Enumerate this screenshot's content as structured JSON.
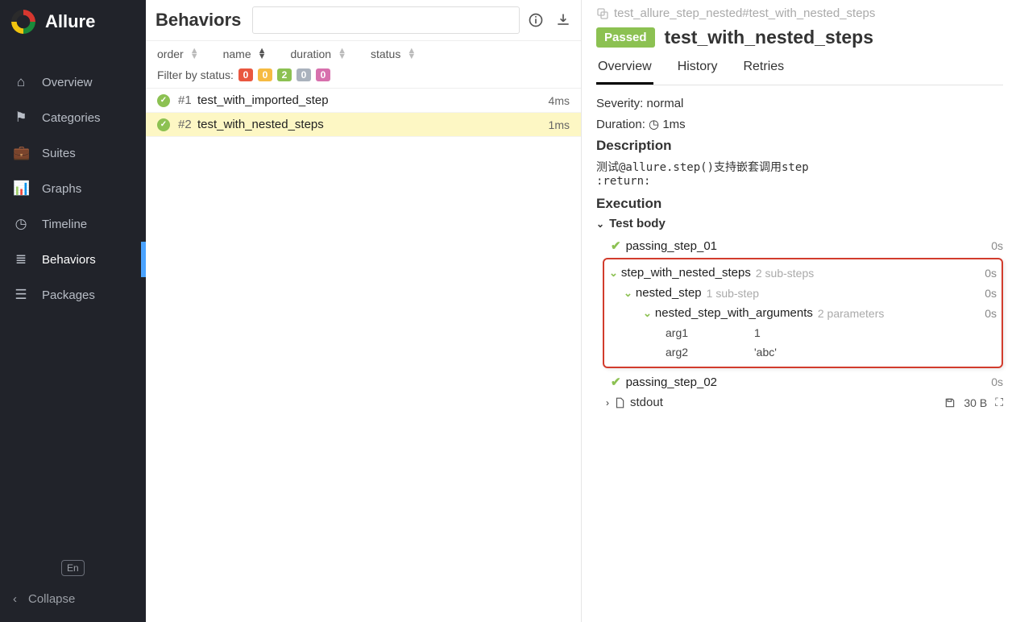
{
  "brand": {
    "title": "Allure"
  },
  "nav": {
    "items": [
      {
        "label": "Overview",
        "icon": "home-icon",
        "glyph": "⌂"
      },
      {
        "label": "Categories",
        "icon": "flag-icon",
        "glyph": "⚑"
      },
      {
        "label": "Suites",
        "icon": "briefcase-icon",
        "glyph": "💼"
      },
      {
        "label": "Graphs",
        "icon": "chart-icon",
        "glyph": "📊"
      },
      {
        "label": "Timeline",
        "icon": "clock-icon",
        "glyph": "◷"
      },
      {
        "label": "Behaviors",
        "icon": "list-icon",
        "glyph": "≣",
        "active": true
      },
      {
        "label": "Packages",
        "icon": "stack-icon",
        "glyph": "☰"
      }
    ],
    "lang": "En",
    "collapse": "Collapse"
  },
  "mid": {
    "title": "Behaviors",
    "search_placeholder": "",
    "sorts": [
      {
        "key": "order",
        "label": "order"
      },
      {
        "key": "name",
        "label": "name",
        "active": true
      },
      {
        "key": "duration",
        "label": "duration"
      },
      {
        "key": "status",
        "label": "status"
      }
    ],
    "filter_label": "Filter by status:",
    "status_filters": [
      {
        "count": "0",
        "color": "#e9573f"
      },
      {
        "count": "0",
        "color": "#f6bb42"
      },
      {
        "count": "2",
        "color": "#8cc152"
      },
      {
        "count": "0",
        "color": "#aab2bd"
      },
      {
        "count": "0",
        "color": "#d770ad"
      }
    ],
    "tests": [
      {
        "idx": "#1",
        "name": "test_with_imported_step",
        "duration": "4ms"
      },
      {
        "idx": "#2",
        "name": "test_with_nested_steps",
        "duration": "1ms",
        "selected": true
      }
    ]
  },
  "detail": {
    "crumb": "test_allure_step_nested#test_with_nested_steps",
    "status_badge": "Passed",
    "title": "test_with_nested_steps",
    "tabs": [
      {
        "label": "Overview",
        "active": true
      },
      {
        "label": "History"
      },
      {
        "label": "Retries"
      }
    ],
    "severity_label": "Severity:",
    "severity_value": "normal",
    "duration_label": "Duration:",
    "duration_value": "1ms",
    "description_heading": "Description",
    "description_text": "测试@allure.step()支持嵌套调用step\n:return:",
    "execution_heading": "Execution",
    "test_body_label": "Test body",
    "steps": {
      "s1": {
        "name": "passing_step_01",
        "dur": "0s"
      },
      "s2": {
        "name": "step_with_nested_steps",
        "sub": "2 sub-steps",
        "dur": "0s"
      },
      "s3": {
        "name": "nested_step",
        "sub": "1 sub-step",
        "dur": "0s"
      },
      "s4": {
        "name": "nested_step_with_arguments",
        "sub": "2 parameters",
        "dur": "0s"
      },
      "params": [
        {
          "k": "arg1",
          "v": "1"
        },
        {
          "k": "arg2",
          "v": "'abc'"
        }
      ],
      "s5": {
        "name": "passing_step_02",
        "dur": "0s"
      }
    },
    "attachment": {
      "name": "stdout",
      "size": "30 B"
    }
  }
}
